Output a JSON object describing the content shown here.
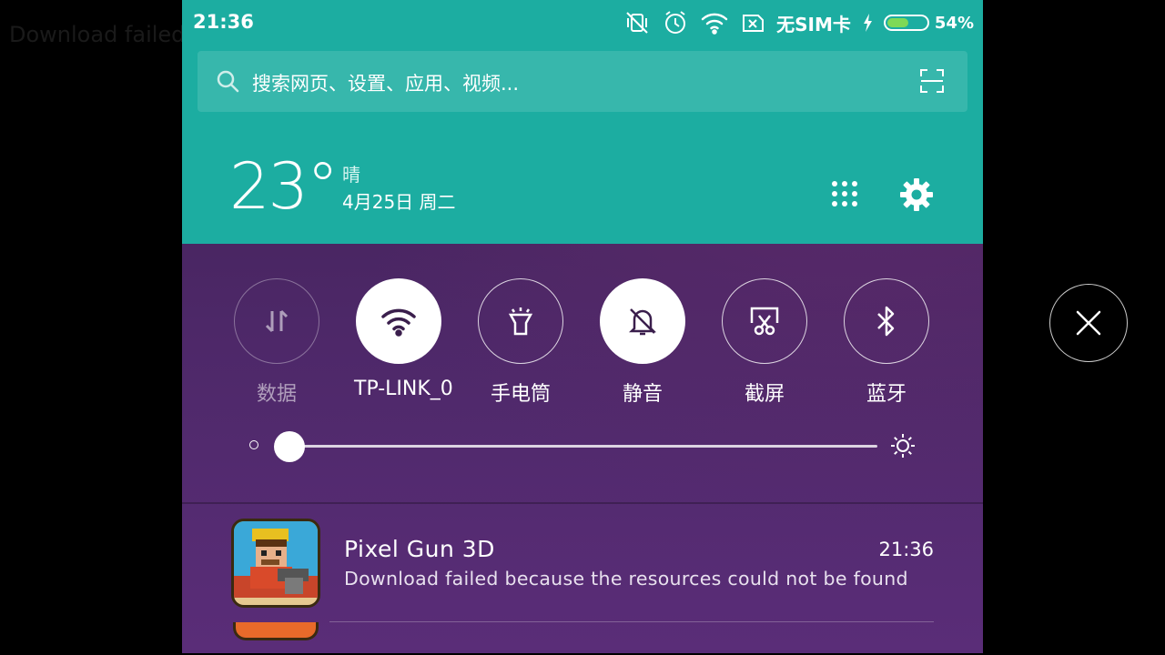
{
  "background_text": "Download failed",
  "status_bar": {
    "time": "21:36",
    "sim_text": "无SIM卡",
    "battery_percent_text": "54%",
    "battery_level": 0.54,
    "icons": [
      "vibrate-off-icon",
      "alarm-icon",
      "wifi-icon",
      "no-sim-icon",
      "charging-icon",
      "battery-icon"
    ]
  },
  "search": {
    "placeholder": "搜索网页、设置、应用、视频..."
  },
  "weather": {
    "temperature": "23°",
    "condition": "晴",
    "date": "4月25日 周二"
  },
  "toggles": [
    {
      "label": "数据",
      "icon": "data-icon",
      "state": "disabled"
    },
    {
      "label": "TP-LINK_0",
      "icon": "wifi-icon",
      "state": "on"
    },
    {
      "label": "手电筒",
      "icon": "flashlight-icon",
      "state": "off"
    },
    {
      "label": "静音",
      "icon": "mute-icon",
      "state": "on"
    },
    {
      "label": "截屏",
      "icon": "screenshot-icon",
      "state": "off"
    },
    {
      "label": "蓝牙",
      "icon": "bluetooth-icon",
      "state": "off"
    }
  ],
  "brightness": {
    "level": 0.0
  },
  "notification": {
    "app": "Pixel Gun 3D",
    "time": "21:36",
    "text": "Download failed because the resources could not be found"
  },
  "colors": {
    "header": "#1cada1",
    "panel": "#4d2868",
    "battery_fill": "#7ed957"
  }
}
